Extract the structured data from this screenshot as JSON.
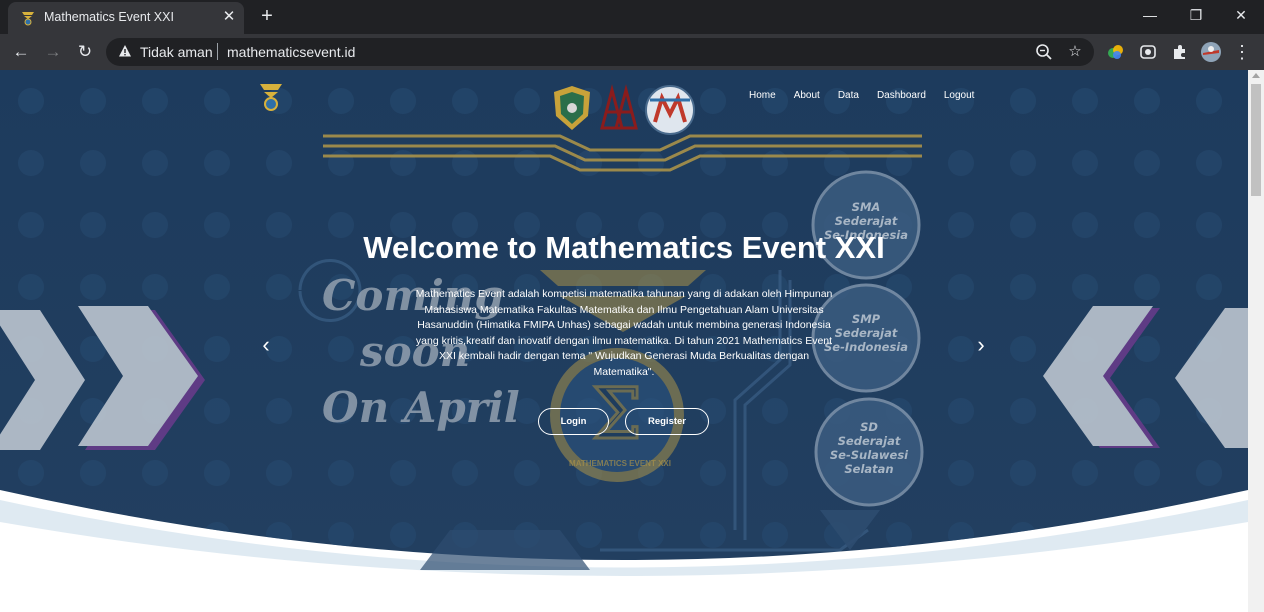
{
  "browser": {
    "tab_title": "Mathematics Event XXI",
    "tab_close": "✕",
    "new_tab": "+",
    "window_controls": {
      "minimize": "—",
      "restore": "❐",
      "close": "✕"
    },
    "nav": {
      "back": "←",
      "forward": "→",
      "reload": "↻"
    },
    "security_label": "Tidak aman",
    "url": "mathematicsevent.id",
    "omnibox_icons": {
      "zoom": "zoom-icon",
      "bookmark": "☆"
    },
    "menu": "⋮"
  },
  "site": {
    "nav_links": [
      "Home",
      "About",
      "Data",
      "Dashboard",
      "Logout"
    ],
    "hero_title": "Welcome to Mathematics Event XXI",
    "hero_description": "Mathematics Event adalah kompetisi matematika tahunan yang di adakan oleh Himpunan Mahasiswa Matematika Fakultas Matematika dan Ilmu Pengetahuan Alam Universitas Hasanuddin (Himatika FMIPA Unhas) sebagai wadah untuk membina generasi Indonesia yang kritis,kreatif dan inovatif dengan ilmu matematika. Di tahun 2021 Mathematics Event XXI kembali hadir dengan tema \" Wujudkan Generasi Muda Berkualitas dengan Matematika\".",
    "login_label": "Login",
    "register_label": "Register",
    "carousel_prev": "‹",
    "carousel_next": "›",
    "poster_text": {
      "coming_line1": "Coming",
      "coming_line2": "soon",
      "coming_line3": "On April",
      "bubble_sma": [
        "SMA",
        "Sederajat",
        "Se-Indonesia"
      ],
      "bubble_smp": [
        "SMP",
        "Sederajat",
        "Se-Indonesia"
      ],
      "bubble_sd": [
        "SD",
        "Sederajat",
        "Se-Sulawesi",
        "Selatan"
      ],
      "emblem_ring": "MATHEMATICS EVENT XXI"
    }
  },
  "colors": {
    "hero_navy": "#1f3f63",
    "accent_gold": "#b59a45",
    "chrome_dark": "#202124",
    "chrome_mid": "#35363a"
  }
}
